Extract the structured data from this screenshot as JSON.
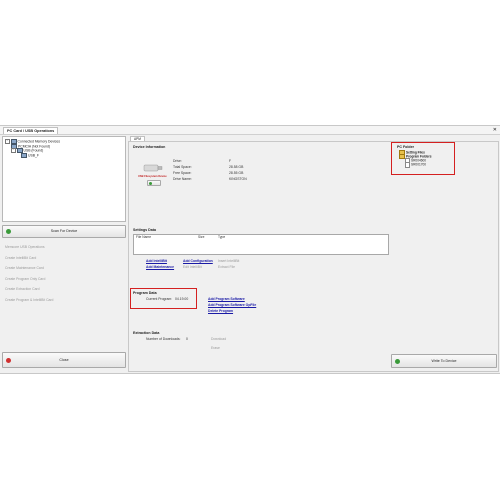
{
  "window": {
    "title": "PC Card / USB Operations",
    "close_glyph": "✕"
  },
  "tree": {
    "items": [
      {
        "label": "Connected Memory Devices",
        "icon": "device-icon"
      },
      {
        "label": "PCMCIA (Not Found)",
        "icon": "pcmcia-icon"
      },
      {
        "label": "USB (Found)",
        "icon": "usb-icon"
      },
      {
        "label": "USB_F",
        "icon": "usb-drive-icon"
      }
    ]
  },
  "buttons": {
    "scan": "Scan For Device",
    "close": "Close",
    "write": "Write To Device"
  },
  "operations": {
    "items": [
      "Memcore USB Operations",
      "Create IntelliBit Card",
      "Create Maintenance Card",
      "Create Program Only Card",
      "Create Extraction Card",
      "Create Program & IntelliBit Card"
    ]
  },
  "tabs": {
    "active": "APM"
  },
  "device_info": {
    "title": "Device Information",
    "image_label": "USB Filesystem Device",
    "rows": [
      {
        "label": "Drive:",
        "value": "F"
      },
      {
        "label": "Total Space:",
        "value": "28.58 GB"
      },
      {
        "label": "Free Space:",
        "value": "28.55 GB"
      },
      {
        "label": "Drive Name:",
        "value": "KINGSTON"
      }
    ]
  },
  "settings": {
    "title": "Settings Data",
    "columns": [
      "File Name",
      "Size",
      "Type"
    ],
    "links": {
      "add_intellibit": "Add IntelliBit",
      "add_configuration": "Add Configuration",
      "insert_intellibit": "Insert IntelliBit",
      "add_maintenance": "Add Maintenance",
      "edit_intellibit": "Edit IntelliBit",
      "extract_file": "Extract File"
    }
  },
  "program": {
    "title": "Program Data",
    "current_label": "Current Program:",
    "current_value": "04.19.00",
    "links": {
      "add_software": "Add Program Software",
      "add_software_opfile": "Add Program Software OpFile",
      "delete_program": "Delete Program"
    }
  },
  "extraction": {
    "title": "Extraction Data",
    "downloads_label": "Number of Downloads:",
    "downloads_value": "0",
    "download_link": "Download",
    "erase_link": "Erase"
  },
  "pc_folder": {
    "title": "PC Folder",
    "items": [
      {
        "label": "Setting Files",
        "kind": "folder"
      },
      {
        "label": "Program Folders",
        "kind": "folder"
      },
      {
        "label": "SR004600",
        "kind": "file"
      },
      {
        "label": "SR001700",
        "kind": "file"
      }
    ]
  },
  "colors": {
    "highlight_border": "#d42020",
    "link": "#1a1aa6",
    "scan_icon": "#3a9a3a",
    "close_icon": "#d03030",
    "write_icon": "#3a9a3a"
  }
}
